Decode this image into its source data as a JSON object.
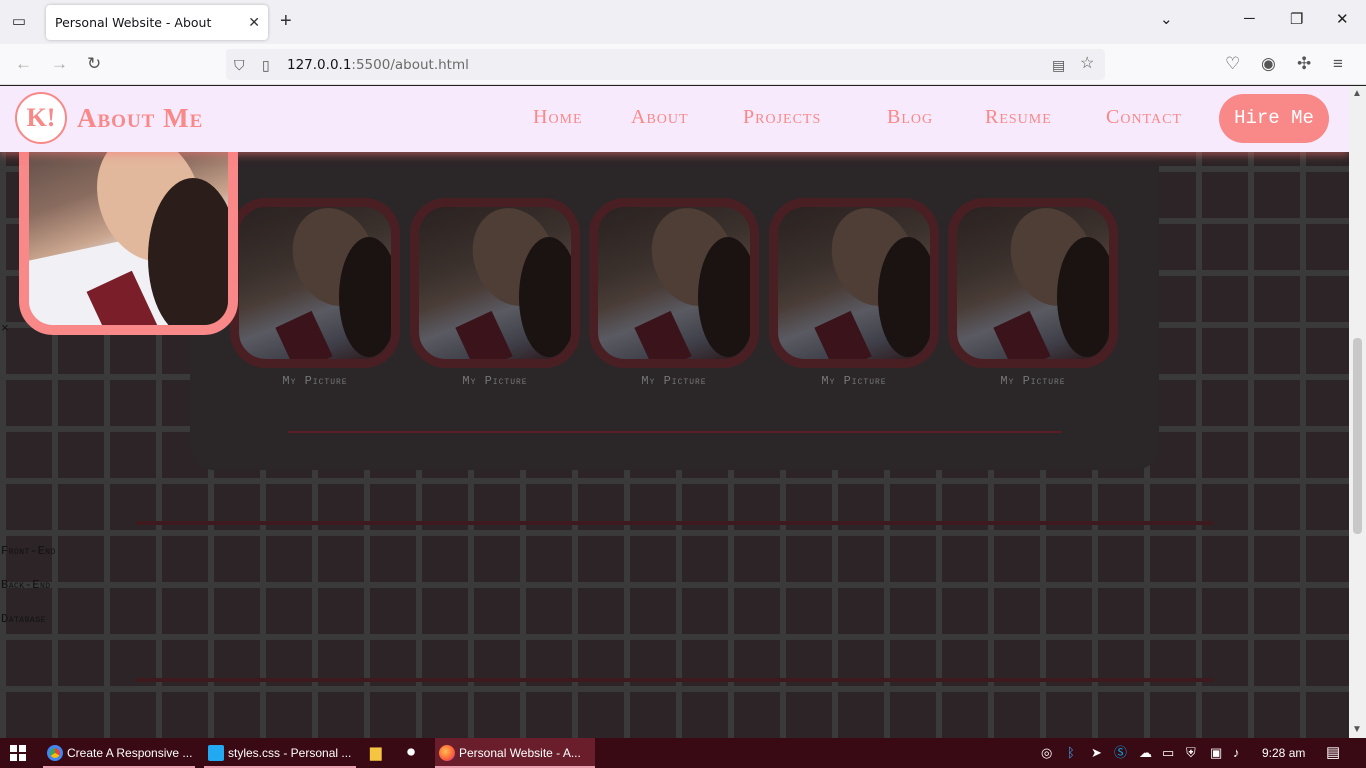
{
  "browser": {
    "tab_title": "Personal Website - About",
    "tab_close_glyph": "✕",
    "new_tab_glyph": "+",
    "url_host": "127.0.0.1",
    "url_rest": ":5500/about.html",
    "icons": [
      "tab-list-icon",
      "back-icon",
      "forward-icon",
      "reload-icon",
      "shield-icon",
      "page-icon",
      "reader-view-icon",
      "bookmark-star-icon",
      "pocket-icon",
      "account-icon",
      "extensions-icon",
      "menu-icon",
      "minimize-icon",
      "restore-icon",
      "close-icon",
      "list-all-tabs-icon"
    ]
  },
  "site": {
    "logo": "K!",
    "title": "About Me",
    "nav": [
      "Home",
      "About",
      "Projects",
      "Blog",
      "Resume",
      "Contact"
    ],
    "hire_button": "Hire Me",
    "accent_color": "#f98888",
    "header_bg": "#f7eafc"
  },
  "modal": {
    "close_glyph": "×"
  },
  "gallery": {
    "captions": [
      "My Picture",
      "My Picture",
      "My Picture",
      "My Picture",
      "My Picture"
    ]
  },
  "skills": [
    "Front-End",
    "Back-End",
    "Database"
  ],
  "taskbar": {
    "items": [
      {
        "label": "Create A Responsive ...",
        "icon": "chrome-icon"
      },
      {
        "label": "styles.css - Personal ...",
        "icon": "vscode-icon"
      },
      {
        "label": "Personal Website - A...",
        "icon": "firefox-icon"
      }
    ],
    "pinned": [
      "file-explorer-icon",
      "record-icon"
    ],
    "tray": [
      "steam-icon",
      "bluetooth-icon",
      "arrow-icon",
      "skype-icon",
      "cloud-icon",
      "camera-icon",
      "security-icon",
      "network-icon",
      "volume-icon"
    ],
    "time": "9:28 am",
    "notification_icon": "notification-icon"
  }
}
